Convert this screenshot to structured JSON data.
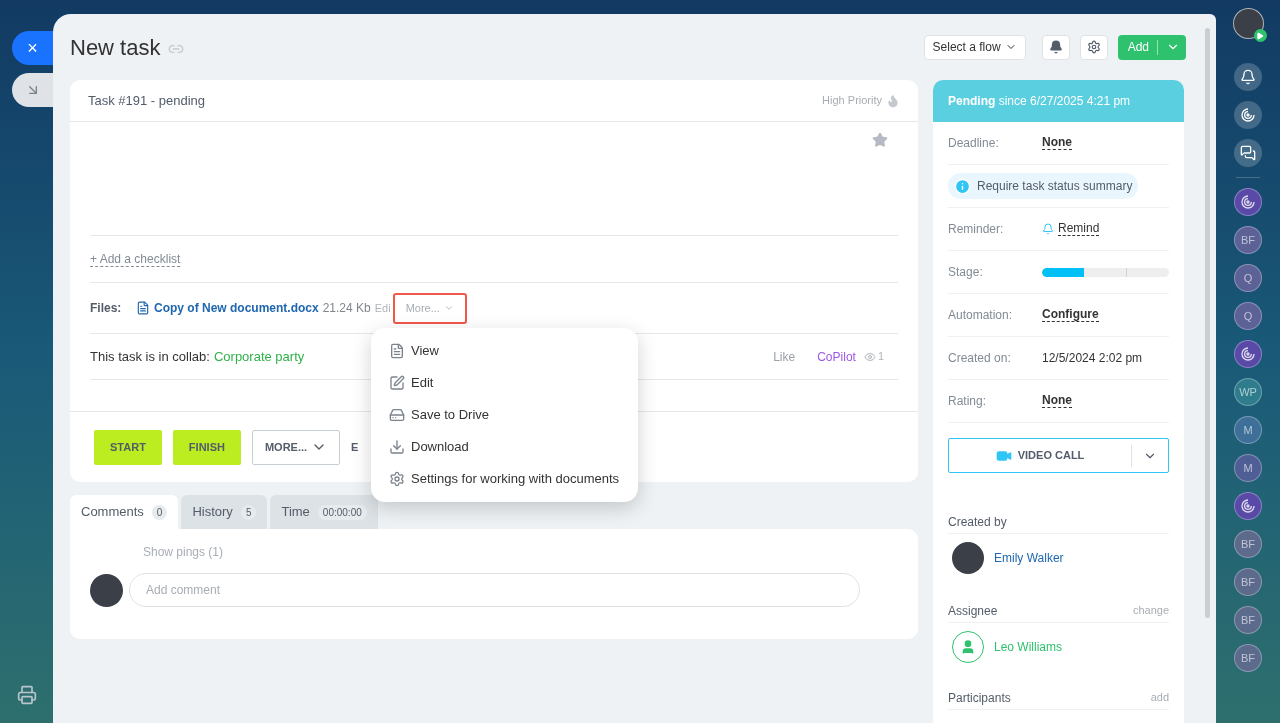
{
  "left_strip": {
    "close_label": "×"
  },
  "header": {
    "title": "New task",
    "flow_select": "Select a flow",
    "add_button": "Add"
  },
  "task": {
    "heading": "Task #191 - pending",
    "priority": "High Priority",
    "favorite": false,
    "add_checklist": "+ Add a checklist",
    "files_label": "Files:",
    "file_name": "Copy of New document.docx",
    "file_size": "21.24 Kb",
    "file_edit": "Edi",
    "more_files": "More...",
    "collab_text": "This task is in collab:",
    "collab_name": "Corporate party",
    "like": "Like",
    "copilot": "CoPilot",
    "views": "1"
  },
  "actions": [
    {
      "label": "START",
      "kind": "primary"
    },
    {
      "label": "FINISH",
      "kind": "primary"
    },
    {
      "label": "MORE...",
      "kind": "dropdown"
    },
    {
      "label": "E",
      "kind": "plain"
    }
  ],
  "file_menu": [
    {
      "label": "View",
      "kind": "view"
    },
    {
      "label": "Edit",
      "kind": "edit"
    },
    {
      "label": "Save to Drive",
      "kind": "drive"
    },
    {
      "label": "Download",
      "kind": "download"
    },
    {
      "label": "Settings for working with documents",
      "kind": "settings"
    }
  ],
  "tabs": [
    {
      "label": "Comments",
      "count": "0",
      "selected": true
    },
    {
      "label": "History",
      "count": "5",
      "selected": false
    },
    {
      "label": "Time",
      "count": "00:00:00",
      "selected": false
    }
  ],
  "comments": {
    "show_pings": "Show pings (1)",
    "placeholder": "Add comment"
  },
  "sidebar": {
    "status": "**Pending** since 6/27/2025 4:21 pm",
    "fields": [
      {
        "label": "Deadline:",
        "value": "None",
        "kind": "link"
      },
      {
        "label": "Require task status summary",
        "kind": "notice"
      },
      {
        "label": "Reminder:",
        "value": "Remind",
        "kind": "reminder"
      },
      {
        "label": "Stage:",
        "kind": "stage",
        "level": 0.33
      },
      {
        "label": "Automation:",
        "value": "Configure",
        "kind": "link"
      },
      {
        "label": "Created on:",
        "value": "12/5/2024 2:02 pm",
        "kind": "text"
      },
      {
        "label": "Rating:",
        "value": "None",
        "kind": "link"
      }
    ],
    "video_call": "VIDEO CALL",
    "created_by_label": "Created by",
    "creator": "Emily Walker",
    "assignee_label": "Assignee",
    "assignee_action": "change",
    "assignee": "Leo Williams",
    "participants_label": "Participants",
    "participants_action": "add"
  },
  "right_strip": [
    {
      "kind": "bell"
    },
    {
      "kind": "swirl-light"
    },
    {
      "kind": "chat"
    },
    {
      "kind": "divider"
    },
    {
      "kind": "swirl",
      "color": "#5a4aa8"
    },
    {
      "kind": "initials",
      "text": "BF",
      "color": "#5c6296"
    },
    {
      "kind": "initials",
      "text": "Q",
      "color": "#5c6296"
    },
    {
      "kind": "initials",
      "text": "Q",
      "color": "#5c6296"
    },
    {
      "kind": "swirl",
      "color": "#5a4aa8"
    },
    {
      "kind": "initials",
      "text": "WP",
      "color": "#2f7d8c"
    },
    {
      "kind": "initials",
      "text": "M",
      "color": "#3d6f98"
    },
    {
      "kind": "initials",
      "text": "M",
      "color": "#4f5f95"
    },
    {
      "kind": "swirl",
      "color": "#5a4aa8"
    },
    {
      "kind": "initials",
      "text": "BF",
      "color": "#5c6a8c"
    },
    {
      "kind": "initials",
      "text": "BF",
      "color": "#5c6a8c"
    },
    {
      "kind": "initials",
      "text": "BF",
      "color": "#5c6a8c"
    },
    {
      "kind": "initials",
      "text": "BF",
      "color": "#5c6a8c"
    }
  ]
}
